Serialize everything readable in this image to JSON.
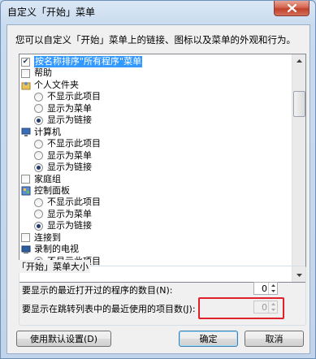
{
  "window": {
    "title": "自定义「开始」菜单",
    "close_icon": "close-icon"
  },
  "description": "您可以自定义「开始」菜单上的链接、图标以及菜单的外观和行为。",
  "tree": {
    "items": [
      {
        "type": "checkbox",
        "checked": true,
        "label": "按名称排序\"所有程序\"菜单",
        "selected": true
      },
      {
        "type": "checkbox",
        "checked": false,
        "label": "帮助"
      },
      {
        "type": "header",
        "icon": "user-folder-icon",
        "label": "个人文件夹"
      },
      {
        "type": "radio",
        "checked": false,
        "label": "不显示此项目"
      },
      {
        "type": "radio",
        "checked": false,
        "label": "显示为菜单"
      },
      {
        "type": "radio",
        "checked": true,
        "label": "显示为链接"
      },
      {
        "type": "header",
        "icon": "computer-icon",
        "label": "计算机"
      },
      {
        "type": "radio",
        "checked": false,
        "label": "不显示此项目"
      },
      {
        "type": "radio",
        "checked": false,
        "label": "显示为菜单"
      },
      {
        "type": "radio",
        "checked": true,
        "label": "显示为链接"
      },
      {
        "type": "checkbox",
        "checked": false,
        "label": "家庭组"
      },
      {
        "type": "header",
        "icon": "control-panel-icon",
        "label": "控制面板"
      },
      {
        "type": "radio",
        "checked": false,
        "label": "不显示此项目"
      },
      {
        "type": "radio",
        "checked": false,
        "label": "显示为菜单"
      },
      {
        "type": "radio",
        "checked": true,
        "label": "显示为链接"
      },
      {
        "type": "checkbox",
        "checked": false,
        "label": "连接到"
      },
      {
        "type": "header",
        "icon": "recorded-tv-icon",
        "label": "录制的电视"
      },
      {
        "type": "radio",
        "checked": true,
        "label": "不显示此项目"
      }
    ]
  },
  "menu_size": {
    "group_label": "「开始」菜单大小",
    "recent_programs_label": "要显示的最近打开过的程序的数目(N):",
    "recent_programs_value": "0",
    "jump_list_label": "要显示在跳转列表中的最近使用的项目数(J):",
    "jump_list_value": "0"
  },
  "buttons": {
    "defaults": "使用默认设置(D)",
    "ok": "确定",
    "cancel": "取消"
  },
  "colors": {
    "selection": "#3399ff",
    "highlight_box": "#e0202a"
  }
}
